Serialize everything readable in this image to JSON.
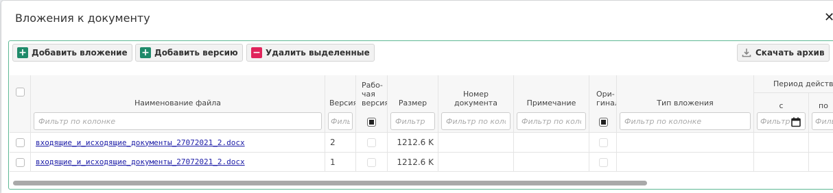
{
  "dialog": {
    "title": "Вложения к документу",
    "close_symbol": "✕"
  },
  "toolbar": {
    "add_attachment": "Добавить вложение",
    "add_version": "Добавить версию",
    "delete_selected": "Удалить выделенные",
    "download_archive": "Скачать архив"
  },
  "columns": {
    "filename": "Наименование файла",
    "version": "Версия",
    "working_version": "Рабо-\nчая\nверсия",
    "size": "Размер",
    "doc_number": "Номер\nдокумента",
    "note": "Примечание",
    "original": "Ори-\nгинал",
    "attachment_type": "Тип вложения",
    "validity_period": "Период действия",
    "period_from": "с",
    "period_to": "по"
  },
  "filters": {
    "filename": "Фильтр по колонке",
    "version": "Фильтр",
    "size": "Фильтр",
    "doc_number": "Фильтр по колонке",
    "note": "Фильтр по колонке",
    "attachment_type": "Фильтр по колонке",
    "period_from": "Фильтр",
    "period_to": "Фильтр"
  },
  "rows": [
    {
      "filename": "входящие_и_исходящие_документы_27072021_2.docx",
      "version": "2",
      "size": "1212.6 K"
    },
    {
      "filename": "входящие_и_исходящие_документы_27072021_2.docx",
      "version": "1",
      "size": "1212.6 K"
    }
  ],
  "colors": {
    "accent": "#1f8a6a",
    "danger": "#e0245b",
    "panel_border": "#5db894",
    "link": "#1a1aa6"
  },
  "icons": {
    "add": "plus-square-icon",
    "delete": "minus-square-icon",
    "download": "download-icon",
    "calendar": "calendar-icon",
    "close": "close-icon"
  }
}
